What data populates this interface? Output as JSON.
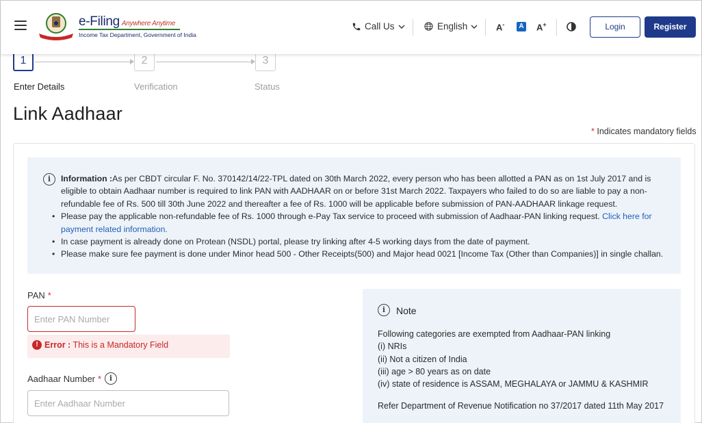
{
  "header": {
    "logo_title": "e-Filing",
    "logo_tagline": "Anywhere Anytime",
    "logo_subtitle": "Income Tax Department, Government of India",
    "call_us": "Call Us",
    "language": "English",
    "font_decrease": "A",
    "font_default": "A",
    "font_increase": "A",
    "login": "Login",
    "register": "Register"
  },
  "stepper": {
    "steps": [
      {
        "number": "1",
        "label": "Enter Details"
      },
      {
        "number": "2",
        "label": "Verification"
      },
      {
        "number": "3",
        "label": "Status"
      }
    ]
  },
  "page": {
    "title": "Link Aadhaar",
    "mandatory_note": "Indicates mandatory fields"
  },
  "information": {
    "heading": "Information :",
    "intro": "As per CBDT circular F. No. 370142/14/22-TPL dated on 30th March 2022, every person who has been allotted a PAN as on 1st July 2017 and is eligible to obtain Aadhaar number is required to link PAN with AADHAAR on or before 31st March 2022. Taxpayers who failed to do so are liable to pay a non-refundable fee of Rs. 500 till 30th June 2022 and thereafter a fee of Rs. 1000 will be applicable before submission of PAN-AADHAAR linkage request.",
    "bullet1": "Please pay the applicable non-refundable fee of Rs. 1000 through e-Pay Tax service to proceed with submission of Aadhaar-PAN linking request. Click here for payment related information.",
    "bullet1_link": "Click here for payment related information.",
    "bullet2": "In case payment is already done on Protean (NSDL) portal, please try linking after 4-5 working days from the date of payment.",
    "bullet3": "Please make sure fee payment is done under Minor head 500 - Other Receipts(500) and Major head 0021 [Income Tax (Other than Companies)] in single challan."
  },
  "form": {
    "pan_label": "PAN",
    "pan_value": "",
    "pan_placeholder": "Enter PAN Number",
    "error_prefix": "Error :",
    "error_message": "This is a Mandatory Field",
    "aadhaar_label": "Aadhaar Number",
    "aadhaar_value": "",
    "aadhaar_placeholder": "Enter Aadhaar Number"
  },
  "note": {
    "title": "Note",
    "intro": "Following categories are exempted from Aadhaar-PAN linking",
    "items": [
      "(i) NRIs",
      "(ii) Not a citizen of India",
      "(iii) age > 80 years as on date",
      "(iv) state of residence is ASSAM, MEGHALAYA or JAMMU & KASHMIR"
    ],
    "reference": "Refer Department of Revenue Notification no 37/2017 dated 11th May 2017"
  },
  "icons": {
    "menu": "hamburger-menu-icon",
    "phone": "phone-icon",
    "globe": "globe-icon",
    "contrast": "contrast-icon",
    "info": "info-icon",
    "error": "error-icon"
  },
  "colors": {
    "primary": "#1f3a8a",
    "link": "#1f5fb4",
    "error": "#c62828",
    "info_bg": "#eef3fa"
  }
}
